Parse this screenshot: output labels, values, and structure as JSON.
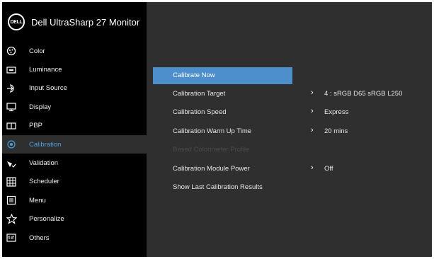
{
  "header": {
    "logo_text": "DELL",
    "model": "Dell UltraSharp 27 Monitor"
  },
  "sidebar": {
    "items": [
      {
        "label": "Color",
        "icon": "color-icon"
      },
      {
        "label": "Luminance",
        "icon": "luminance-icon"
      },
      {
        "label": "Input Source",
        "icon": "input-source-icon"
      },
      {
        "label": "Display",
        "icon": "display-icon"
      },
      {
        "label": "PBP",
        "icon": "pbp-icon"
      },
      {
        "label": "Calibration",
        "icon": "calibration-icon",
        "active": true
      },
      {
        "label": "Validation",
        "icon": "validation-icon"
      },
      {
        "label": "Scheduler",
        "icon": "scheduler-icon"
      },
      {
        "label": "Menu",
        "icon": "menu-icon"
      },
      {
        "label": "Personalize",
        "icon": "star-icon"
      },
      {
        "label": "Others",
        "icon": "others-icon"
      }
    ]
  },
  "calibration": {
    "items": [
      {
        "label": "Calibrate Now",
        "selected": true
      },
      {
        "label": "Calibration Target",
        "value": "4 : sRGB D65 sRGB L250"
      },
      {
        "label": "Calibration Speed",
        "value": "Express"
      },
      {
        "label": "Calibration Warm Up Time",
        "value": "20 mins"
      },
      {
        "label": "Based Colorimeter Profile",
        "disabled": true
      },
      {
        "label": "Calibration Module Power",
        "value": "Off"
      },
      {
        "label": "Show Last Calibration Results"
      }
    ],
    "arrow_glyph": "›"
  },
  "colors": {
    "accent": "#4d9de0",
    "selected_bar": "#4d8fcc",
    "panel": "#2f2f2f",
    "sidebar": "#000000"
  }
}
